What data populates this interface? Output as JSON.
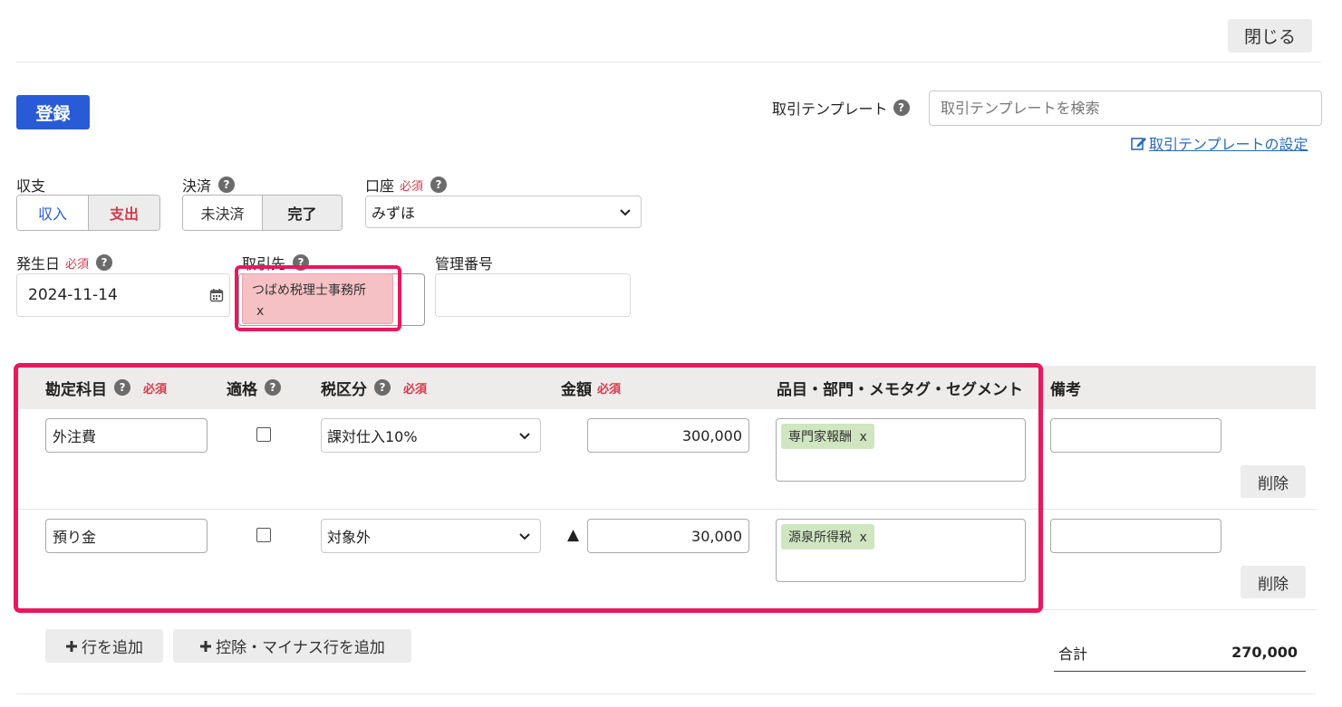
{
  "header": {
    "close_label": "閉じる"
  },
  "toolbar": {
    "register_label": "登録"
  },
  "template": {
    "label": "取引テンプレート",
    "placeholder": "取引テンプレートを検索",
    "settings_link": "取引テンプレートの設定"
  },
  "form": {
    "income_expense": {
      "label": "収支",
      "options": [
        "収入",
        "支出"
      ],
      "selected": "支出"
    },
    "settlement": {
      "label": "決済",
      "options": [
        "未決済",
        "完了"
      ],
      "selected": "完了"
    },
    "account": {
      "label": "口座",
      "required": "必須",
      "value": "みずほ"
    },
    "date": {
      "label": "発生日",
      "required": "必須",
      "value": "2024-11-14"
    },
    "partner": {
      "label": "取引先",
      "value": "つばめ税理士事務所",
      "remove": "x"
    },
    "control_number": {
      "label": "管理番号",
      "value": ""
    }
  },
  "table": {
    "headers": {
      "account": "勘定科目",
      "account_required": "必須",
      "qualified": "適格",
      "tax": "税区分",
      "tax_required": "必須",
      "amount": "金額",
      "amount_required": "必須",
      "tags": "品目・部門・メモタグ・セグメント",
      "note": "備考"
    },
    "rows": [
      {
        "account": "外注費",
        "tax": "課対仕入10%",
        "minus": "",
        "amount": "300,000",
        "tag": "専門家報酬",
        "tag_remove": "x",
        "note": "",
        "delete": "削除"
      },
      {
        "account": "預り金",
        "tax": "対象外",
        "minus": "▲",
        "amount": "30,000",
        "tag": "源泉所得税",
        "tag_remove": "x",
        "note": "",
        "delete": "削除"
      }
    ]
  },
  "actions": {
    "add_row": "行を追加",
    "add_deduction_row": "控除・マイナス行を追加"
  },
  "total": {
    "label": "合計",
    "value": "270,000"
  },
  "colors": {
    "primary": "#2a5bd7",
    "highlight": "#e8185f",
    "expense": "#d43a4a",
    "income": "#2a5bd7",
    "tag": "#cfe6c0"
  }
}
